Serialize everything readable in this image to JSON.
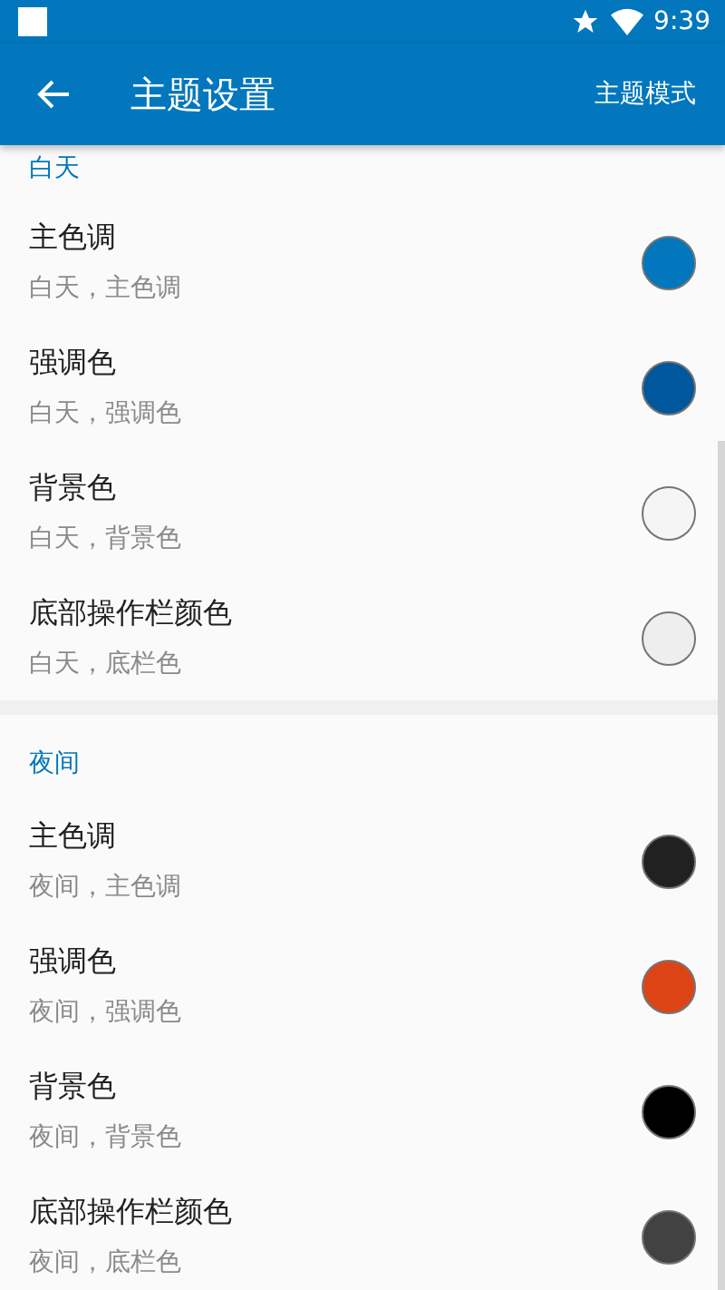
{
  "status_bar": {
    "time": "9:39"
  },
  "toolbar": {
    "title": "主题设置",
    "action": "主题模式"
  },
  "sections": [
    {
      "header": "白天",
      "items": [
        {
          "title": "主色调",
          "subtitle": "白天，主色调",
          "color": "#0277bd"
        },
        {
          "title": "强调色",
          "subtitle": "白天，强调色",
          "color": "#01579b"
        },
        {
          "title": "背景色",
          "subtitle": "白天，背景色",
          "color": "#f5f5f5"
        },
        {
          "title": "底部操作栏颜色",
          "subtitle": "白天，底栏色",
          "color": "#eeeeee"
        }
      ]
    },
    {
      "header": "夜间",
      "items": [
        {
          "title": "主色调",
          "subtitle": "夜间，主色调",
          "color": "#212121"
        },
        {
          "title": "强调色",
          "subtitle": "夜间，强调色",
          "color": "#dd4415"
        },
        {
          "title": "背景色",
          "subtitle": "夜间，背景色",
          "color": "#000000"
        },
        {
          "title": "底部操作栏颜色",
          "subtitle": "夜间，底栏色",
          "color": "#424242"
        }
      ]
    }
  ]
}
